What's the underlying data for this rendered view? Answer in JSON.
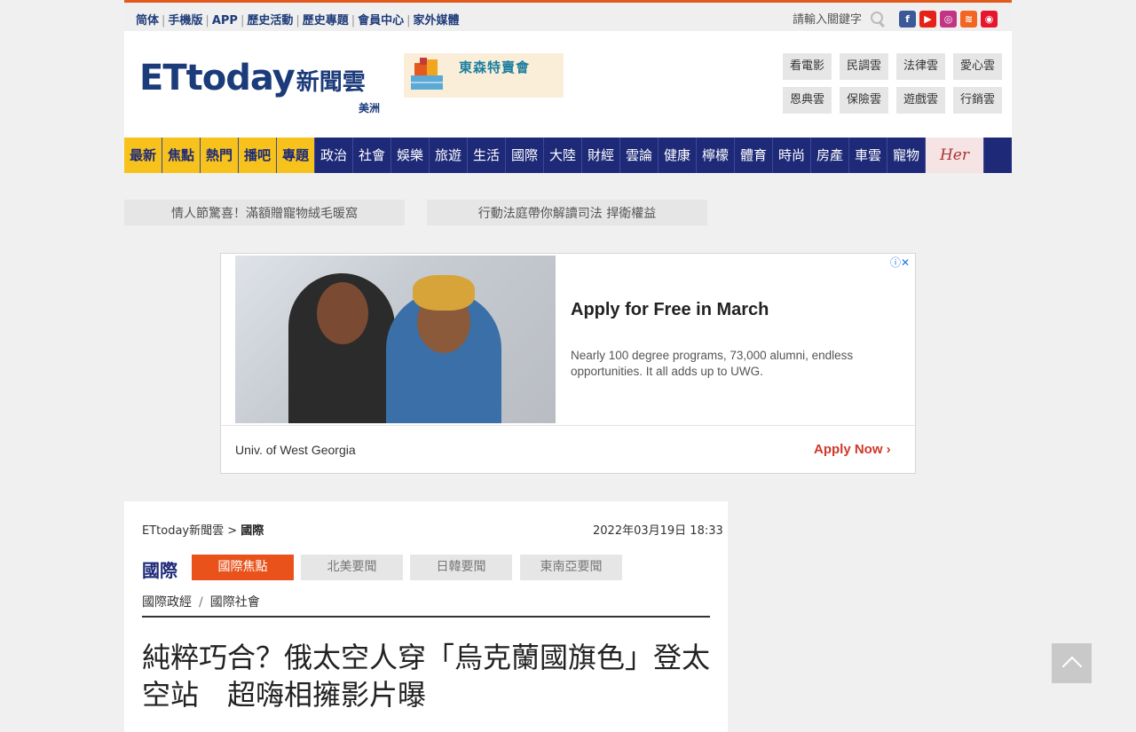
{
  "topbar": {
    "links": [
      "简体",
      "手機版",
      "APP",
      "歷史活動",
      "歷史專題",
      "會員中心",
      "家外媒體"
    ],
    "search_placeholder": "請輸入關鍵字",
    "social_icons": [
      "facebook-icon",
      "youtube-icon",
      "instagram-icon",
      "rss-icon",
      "weibo-icon"
    ],
    "social_colors": {
      "facebook": "#3b5998",
      "youtube": "#e62117",
      "instagram": "#c13584",
      "rss": "#f26522",
      "weibo": "#e6162d"
    }
  },
  "header": {
    "logo_latin": "ETtoday",
    "logo_cn": "新聞雲",
    "region": "美洲",
    "banner_text": "東森特賣會",
    "clouds": [
      "看電影",
      "民調雲",
      "法律雲",
      "愛心雲",
      "恩典雲",
      "保險雲",
      "遊戲雲",
      "行銷雲"
    ]
  },
  "nav": {
    "highlight_items": [
      "最新",
      "焦點",
      "熱門",
      "播吧",
      "專題"
    ],
    "items": [
      "政治",
      "社會",
      "娛樂",
      "旅遊",
      "生活",
      "國際",
      "大陸",
      "財經",
      "雲論",
      "健康",
      "檸檬",
      "體育",
      "時尚",
      "房產",
      "車雲",
      "寵物"
    ],
    "her_label": "Her"
  },
  "promos": [
    "情人節驚喜！滿額贈寵物絨毛暖窩",
    "行動法庭帶你解讀司法 捍衛權益"
  ],
  "ad": {
    "title": "Apply for Free in March",
    "description": "Nearly 100 degree programs, 73,000 alumni, endless opportunities. It all adds up to UWG.",
    "sponsor": "Univ. of West Georgia",
    "cta": "Apply Now",
    "adchoices_icon": "ⓘ✕"
  },
  "article": {
    "breadcrumb_home": "ETtoday新聞雲 >",
    "breadcrumb_section": "國際",
    "date": "2022年03月19日 18:33",
    "section_title": "國際",
    "subtabs": [
      "國際焦點",
      "北美要聞",
      "日韓要聞",
      "東南亞要聞"
    ],
    "subcats": [
      "國際政經",
      "國際社會"
    ],
    "subcat_separator": "/",
    "headline": "純粹巧合？俄太空人穿「烏克蘭國旗色」登太空站　超嗨相擁影片曝"
  },
  "colors": {
    "nav_bg": "#1e2a78",
    "accent_orange": "#e9531b",
    "nav_highlight": "#f7c21b"
  }
}
